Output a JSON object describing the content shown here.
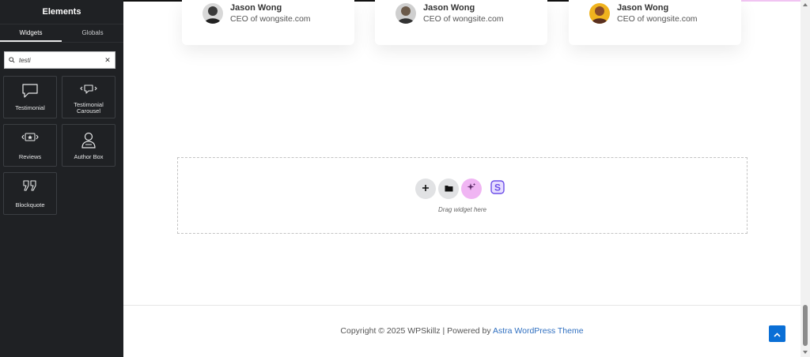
{
  "sidebar": {
    "title": "Elements",
    "tabs": [
      {
        "label": "Widgets",
        "active": true
      },
      {
        "label": "Globals",
        "active": false
      }
    ],
    "search": {
      "value": "testi",
      "placeholder": ""
    },
    "widgets": [
      {
        "label": "Testimonial",
        "icon": "speech-bubble-icon"
      },
      {
        "label": "Testimonial Carousel",
        "icon": "bubble-carousel-icon"
      },
      {
        "label": "Reviews",
        "icon": "reviews-star-icon"
      },
      {
        "label": "Author Box",
        "icon": "person-icon"
      },
      {
        "label": "Blockquote",
        "icon": "quote-icon"
      }
    ]
  },
  "cards": [
    {
      "name": "Jason Wong",
      "role": "CEO of wongsite.com"
    },
    {
      "name": "Jason Wong",
      "role": "CEO of wongsite.com"
    },
    {
      "name": "Jason Wong",
      "role": "CEO of wongsite.com"
    }
  ],
  "dropzone": {
    "text": "Drag widget here"
  },
  "footer": {
    "text": "Copyright © 2025 WPSkillz | Powered by ",
    "link": "Astra WordPress Theme"
  },
  "colors": {
    "sidebar_bg": "#1f2124",
    "ai_button": "#f0b5f3",
    "accent_blue": "#0a6fd6",
    "link_blue": "#2f6fc0"
  }
}
